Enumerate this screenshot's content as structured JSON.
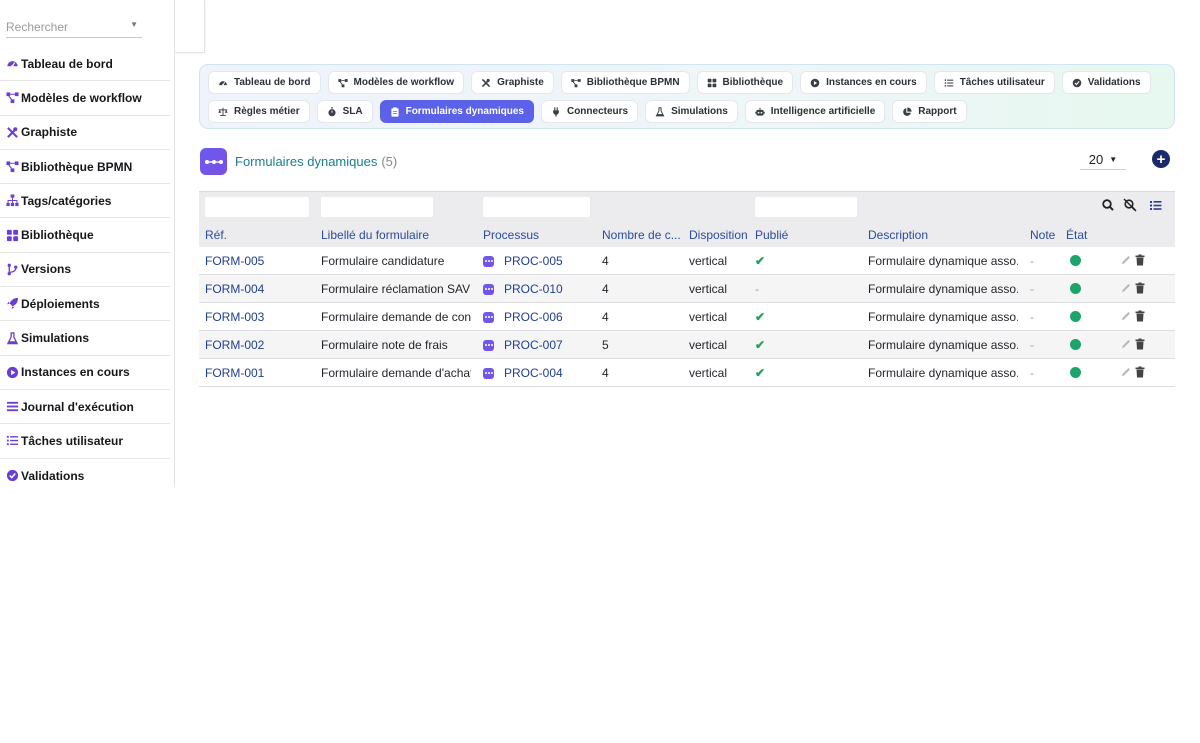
{
  "search": {
    "placeholder": "Rechercher"
  },
  "sidebar": {
    "items": [
      {
        "label": "Tableau de bord",
        "icon": "gauge-icon",
        "color": "#6a3fd0"
      },
      {
        "label": "Modèles de workflow",
        "icon": "workflow-icon",
        "color": "#6a3fd0"
      },
      {
        "label": "Graphiste",
        "icon": "tools-icon",
        "color": "#6a3fd0"
      },
      {
        "label": "Bibliothèque BPMN",
        "icon": "workflow-icon",
        "color": "#6a3fd0"
      },
      {
        "label": "Tags/catégories",
        "icon": "sitemap-icon",
        "color": "#6a3fd0"
      },
      {
        "label": "Bibliothèque",
        "icon": "grid-icon",
        "color": "#6a3fd0"
      },
      {
        "label": "Versions",
        "icon": "branch-icon",
        "color": "#6a3fd0"
      },
      {
        "label": "Déploiements",
        "icon": "rocket-icon",
        "color": "#6a3fd0"
      },
      {
        "label": "Simulations",
        "icon": "flask-icon",
        "color": "#6a3fd0"
      },
      {
        "label": "Instances en cours",
        "icon": "play-circle-icon",
        "color": "#6a3fd0"
      },
      {
        "label": "Journal d'exécution",
        "icon": "list-icon",
        "color": "#6a3fd0"
      },
      {
        "label": "Tâches utilisateur",
        "icon": "tasks-icon",
        "color": "#6a3fd0"
      },
      {
        "label": "Validations",
        "icon": "check-circle-icon",
        "color": "#6a3fd0"
      }
    ]
  },
  "tabs": {
    "row1": [
      {
        "label": "Tableau de bord",
        "icon": "gauge-icon"
      },
      {
        "label": "Modèles de workflow",
        "icon": "workflow-icon"
      },
      {
        "label": "Graphiste",
        "icon": "tools-icon"
      },
      {
        "label": "Bibliothèque BPMN",
        "icon": "workflow-icon"
      },
      {
        "label": "Bibliothèque",
        "icon": "grid-icon"
      },
      {
        "label": "Instances en cours",
        "icon": "play-circle-icon"
      },
      {
        "label": "Tâches utilisateur",
        "icon": "tasks-icon"
      },
      {
        "label": "Validations",
        "icon": "check-circle-icon"
      }
    ],
    "row2": [
      {
        "label": "Règles métier",
        "icon": "scale-icon"
      },
      {
        "label": "SLA",
        "icon": "stopwatch-icon"
      },
      {
        "label": "Formulaires dynamiques",
        "icon": "clipboard-icon",
        "active": true
      },
      {
        "label": "Connecteurs",
        "icon": "plug-icon"
      },
      {
        "label": "Simulations",
        "icon": "flask-icon"
      },
      {
        "label": "Intelligence artificielle",
        "icon": "robot-icon"
      },
      {
        "label": "Rapport",
        "icon": "pie-chart-icon"
      }
    ]
  },
  "header": {
    "title": "Formulaires dynamiques",
    "count": "(5)",
    "page_size": "20",
    "accent": "#1a7f8c"
  },
  "table": {
    "columns": [
      "Réf.",
      "Libellé du formulaire",
      "Processus",
      "Nombre de c...",
      "Disposition",
      "Publié",
      "Description",
      "Note",
      "État"
    ],
    "rows": [
      {
        "ref": "FORM-005",
        "label": "Formulaire candidature",
        "process": "PROC-005",
        "count": "4",
        "layout": "vertical",
        "published": "✔",
        "description": "Formulaire dynamique asso...",
        "note": "-"
      },
      {
        "ref": "FORM-004",
        "label": "Formulaire réclamation SAV",
        "process": "PROC-010",
        "count": "4",
        "layout": "vertical",
        "published": "-",
        "description": "Formulaire dynamique asso...",
        "note": "-"
      },
      {
        "ref": "FORM-003",
        "label": "Formulaire demande de con...",
        "process": "PROC-006",
        "count": "4",
        "layout": "vertical",
        "published": "✔",
        "description": "Formulaire dynamique asso...",
        "note": "-"
      },
      {
        "ref": "FORM-002",
        "label": "Formulaire note de frais",
        "process": "PROC-007",
        "count": "5",
        "layout": "vertical",
        "published": "✔",
        "description": "Formulaire dynamique asso...",
        "note": "-"
      },
      {
        "ref": "FORM-001",
        "label": "Formulaire demande d'achat",
        "process": "PROC-004",
        "count": "4",
        "layout": "vertical",
        "published": "✔",
        "description": "Formulaire dynamique asso...",
        "note": "-"
      }
    ],
    "status_color": "#1ea36a"
  }
}
